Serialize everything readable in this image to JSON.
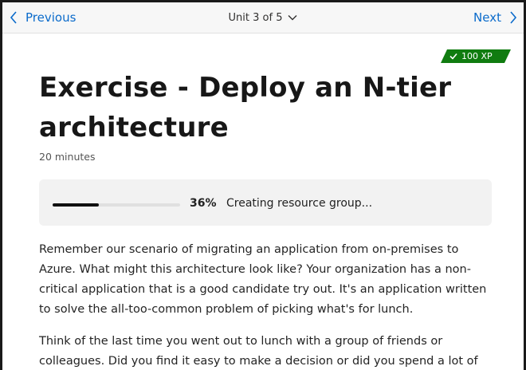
{
  "nav": {
    "previous_label": "Previous",
    "next_label": "Next",
    "unit_label": "Unit 3 of 5"
  },
  "badge": {
    "xp_label": "100 XP"
  },
  "module": {
    "title": "Exercise - Deploy an N-tier architecture",
    "duration": "20 minutes"
  },
  "progress": {
    "percent": 36,
    "percent_label": "36%",
    "status": "Creating resource group..."
  },
  "content": {
    "paragraphs": [
      "Remember our scenario of migrating an application from on-premises to Azure. What might this architecture look like? Your organization has a non-critical application that is a good candidate try out. It's an application written to solve the all-too-common problem of picking what's for lunch.",
      "Think of the last time you went out to lunch with a group of friends or colleagues. Did you find it easy to make a decision or did you spend a lot of"
    ]
  },
  "colors": {
    "link": "#0b6bcb",
    "badge_green": "#107c10",
    "progress_fill": "#111111"
  },
  "icons": {
    "previous": "chevron-left-icon",
    "next": "chevron-right-icon",
    "unit_dropdown": "chevron-down-icon",
    "badge": "check-icon"
  }
}
